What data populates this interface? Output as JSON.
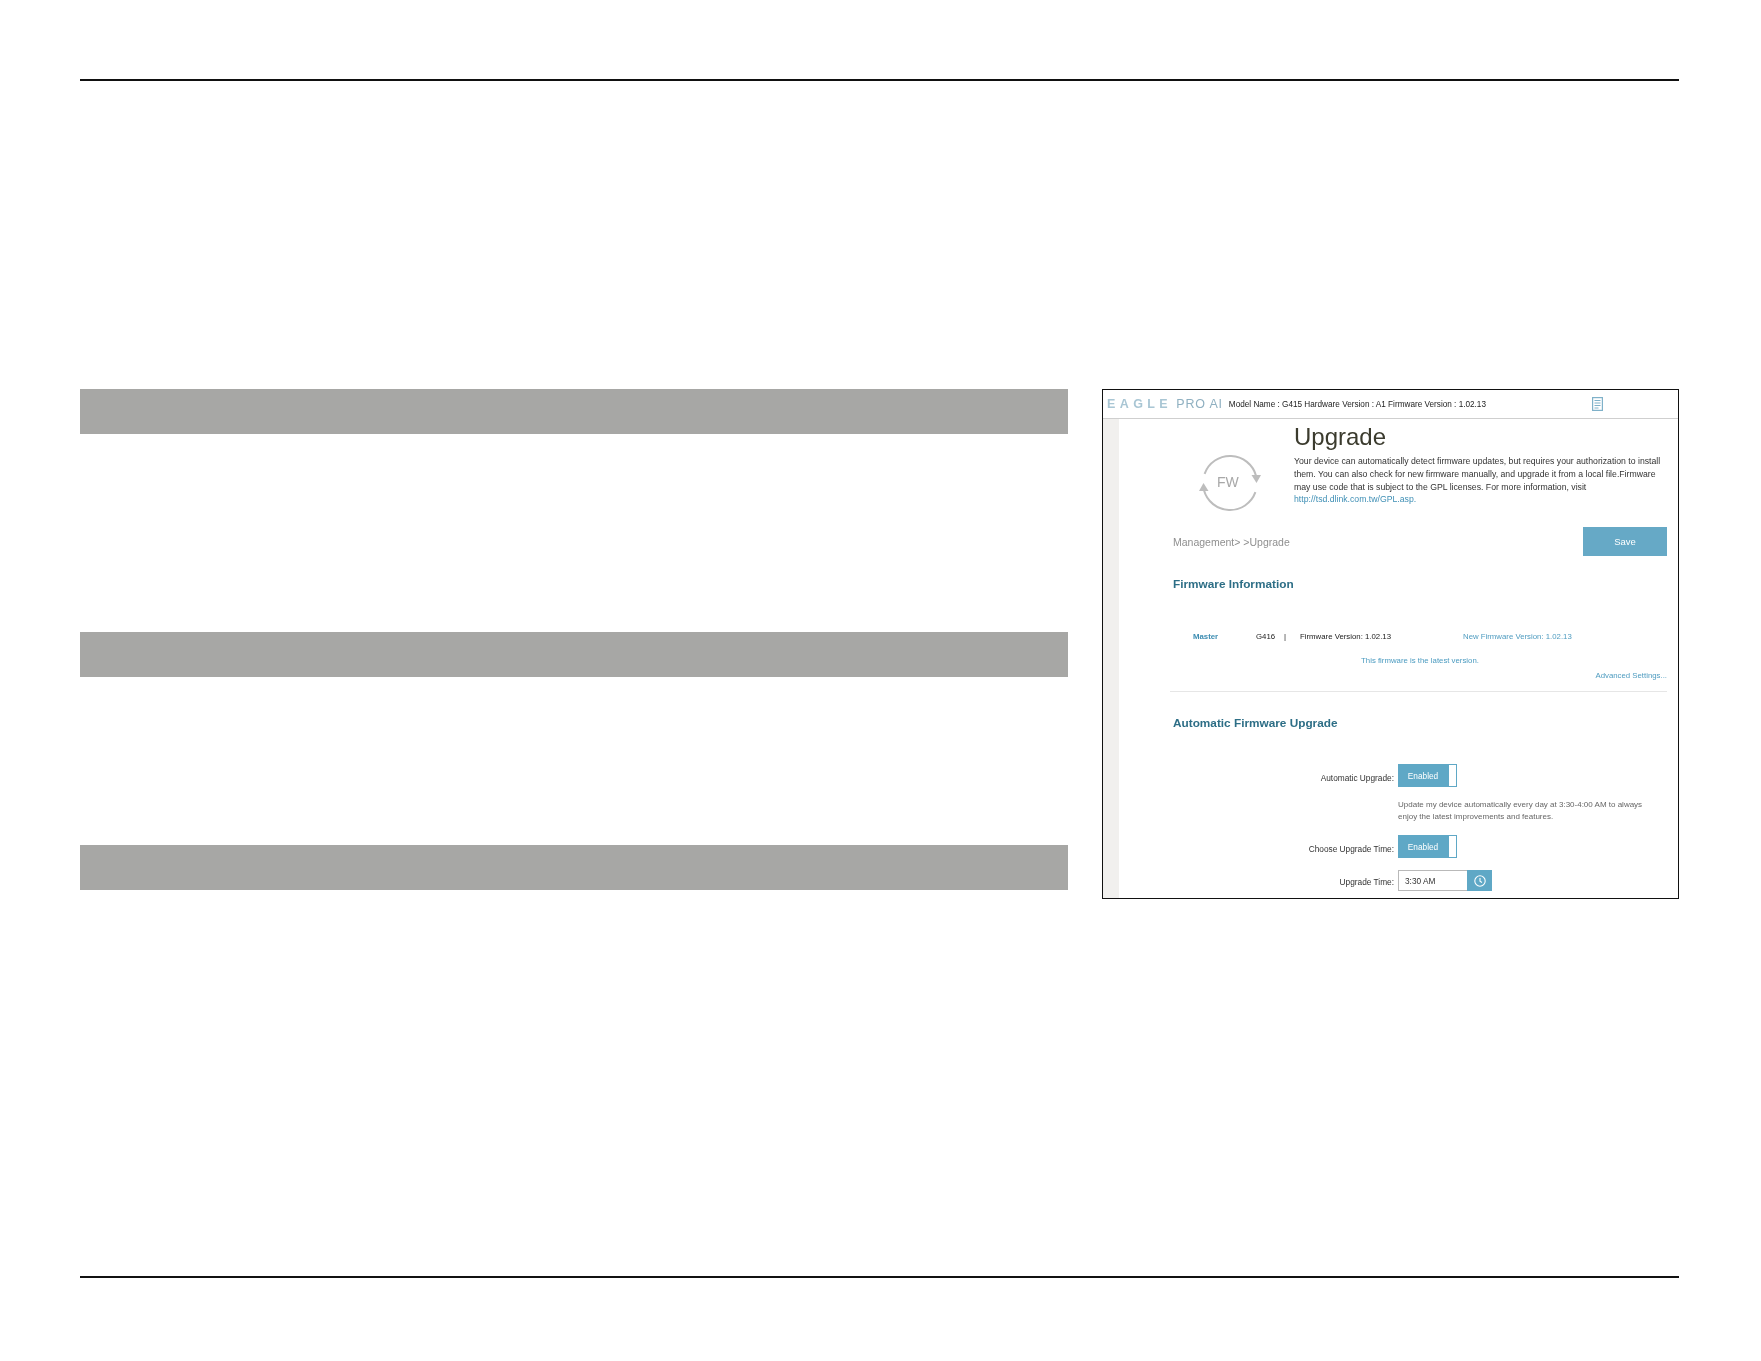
{
  "screenshot": {
    "header": {
      "logo": "**EAGLE** PRO AI",
      "device_info": "Model Name : G415 Hardware Version : A1 Firmware Version : 1.02.13"
    },
    "intro": {
      "icon_label": "FW",
      "title": "Upgrade",
      "description": "Your device can automatically detect firmware updates, but requires your authorization to install them. You can also check for new firmware manually, and upgrade it from a local file.Firmware may use code that is subject to the GPL licenses. For more information, visit",
      "link": "http://tsd.dlink.com.tw/GPL.asp."
    },
    "toolbar": {
      "breadcrumb": "Management> >Upgrade",
      "save_button": "Save"
    },
    "firmware_information": {
      "heading": "Firmware Information",
      "devices": [
        {
          "role": "Master",
          "model": "G416",
          "separator": "|",
          "firmware_version": "Firmware Version: 1.02.13",
          "new_firmware_version": "New Firmware Version: 1.02.13"
        }
      ],
      "status": "This firmware is the latest version.",
      "advanced_settings_link": "Advanced Settings..."
    },
    "automatic_firmware_upgrade": {
      "heading": "Automatic Firmware Upgrade",
      "settings": [
        {
          "kind": "toggle",
          "label": "Automatic Upgrade:",
          "on": true,
          "state_text": "Enabled",
          "note": "Update my device automatically every day at 3:30-4:00 AM to always enjoy the latest improvements and features."
        },
        {
          "kind": "toggle",
          "label": "Choose Upgrade Time:",
          "on": true,
          "state_text": "Enabled"
        },
        {
          "kind": "time",
          "label": "Upgrade Time:",
          "value": "3:30 AM"
        }
      ]
    }
  }
}
